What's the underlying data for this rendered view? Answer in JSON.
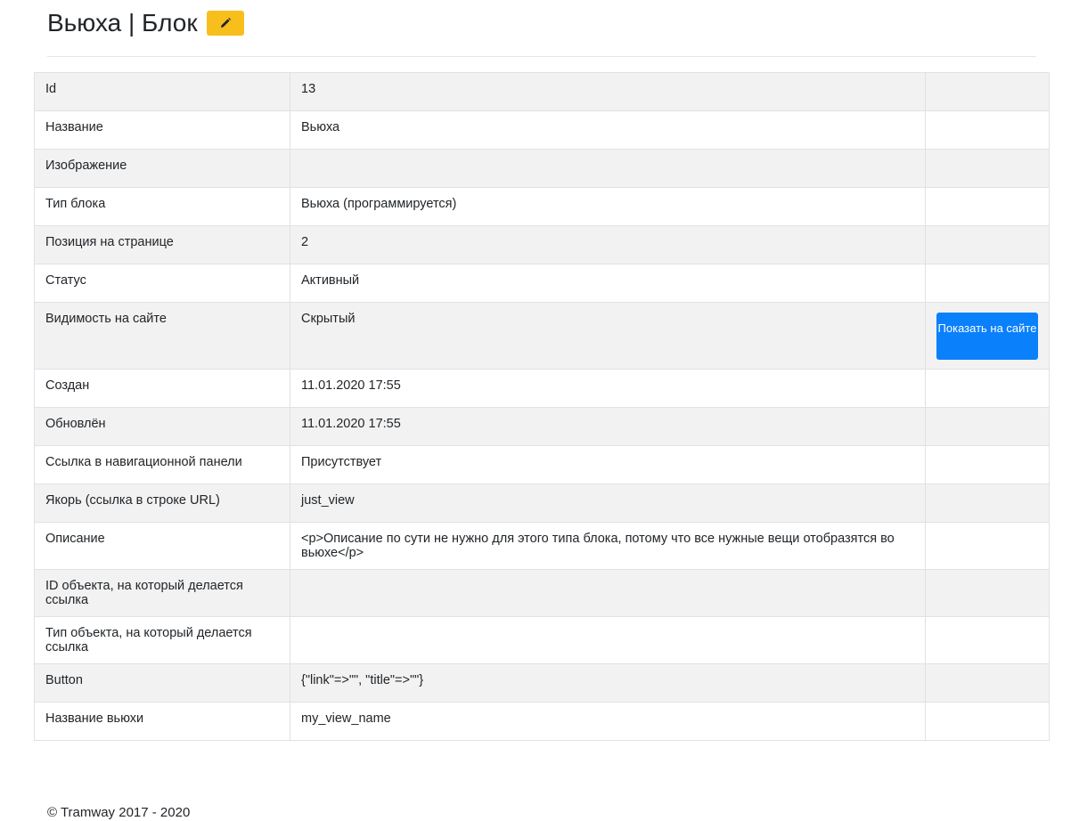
{
  "header": {
    "title": "Вьюха | Блок",
    "edit_icon": "pencil-icon"
  },
  "table": {
    "rows": [
      {
        "label": "Id",
        "value": "13"
      },
      {
        "label": "Название",
        "value": "Вьюха"
      },
      {
        "label": "Изображение",
        "value": ""
      },
      {
        "label": "Тип блока",
        "value": "Вьюха (программируется)"
      },
      {
        "label": "Позиция на странице",
        "value": "2"
      },
      {
        "label": "Статус",
        "value": "Активный"
      },
      {
        "label": "Видимость на сайте",
        "value": "Скрытый",
        "action": "Показать на сайте"
      },
      {
        "label": "Создан",
        "value": "11.01.2020 17:55"
      },
      {
        "label": "Обновлён",
        "value": "11.01.2020 17:55"
      },
      {
        "label": "Ссылка в навигационной панели",
        "value": "Присутствует"
      },
      {
        "label": "Якорь (ссылка в строке URL)",
        "value": "just_view"
      },
      {
        "label": "Описание",
        "value": "<p>Описание по сути не нужно для этого типа блока, потому что все нужные вещи отобразятся во вьюхе</p>"
      },
      {
        "label": "ID объекта, на который делается ссылка",
        "value": ""
      },
      {
        "label": "Тип объекта, на который делается ссылка",
        "value": ""
      },
      {
        "label": "Button",
        "value": "{\"link\"=>\"\", \"title\"=>\"\"}"
      },
      {
        "label": "Название вьюхи",
        "value": "my_view_name"
      }
    ]
  },
  "colors": {
    "edit_button": "#f8be1c",
    "primary_button": "#0a80fb",
    "stripe": "#f2f2f2"
  },
  "footer": {
    "copyright": "© Tramway 2017 - 2020"
  }
}
